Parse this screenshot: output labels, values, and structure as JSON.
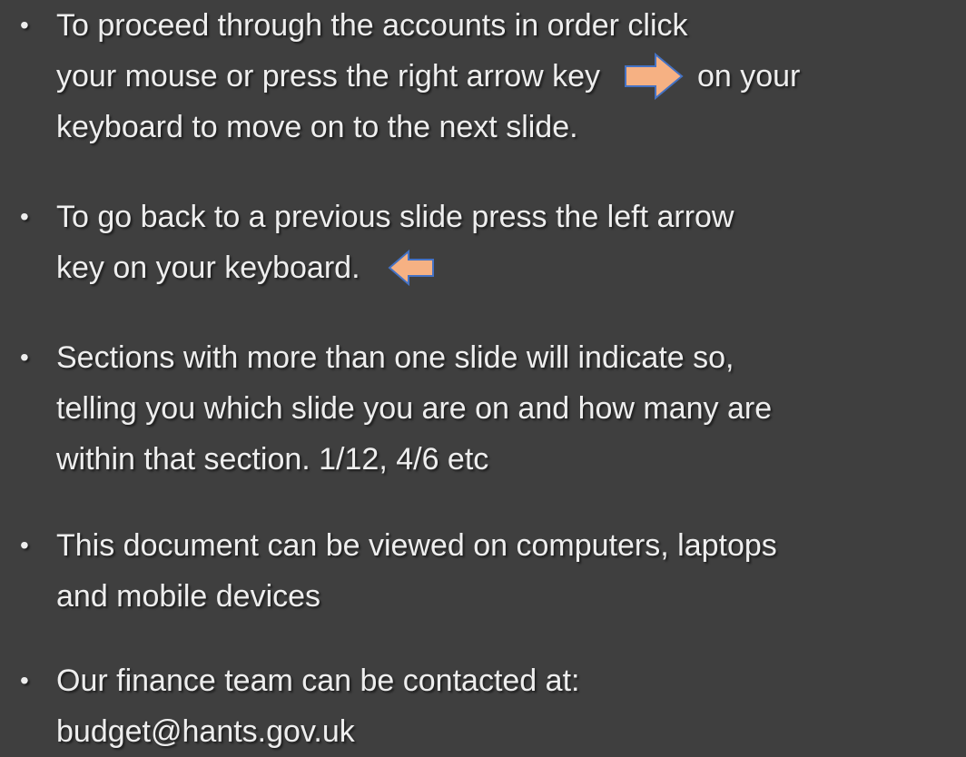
{
  "slide": {
    "background_color": "#3f3f3f",
    "text_color": "#eeeeee",
    "arrow_fill": "#f6b183",
    "arrow_stroke": "#4472c4",
    "bullet_symbol": "•",
    "bullets": [
      {
        "lines": [
          "To proceed through the accounts in order click",
          "your mouse or press the right arrow key",
          "on your",
          "keyboard to move on to the next slide."
        ]
      },
      {
        "lines": [
          "To go back to a previous slide press the left arrow",
          "key on your keyboard."
        ]
      },
      {
        "lines": [
          "Sections with more than one slide will indicate so,",
          "telling you which slide you are on and how many are",
          "within that section. 1/12, 4/6 etc"
        ]
      },
      {
        "lines": [
          "This document can be viewed on computers, laptops",
          "and mobile devices"
        ]
      },
      {
        "lines": [
          "Our finance team can be contacted at:",
          "budget@hants.gov.uk"
        ]
      }
    ],
    "icons": {
      "right_arrow": "right-arrow-icon",
      "left_arrow": "left-arrow-icon"
    }
  }
}
